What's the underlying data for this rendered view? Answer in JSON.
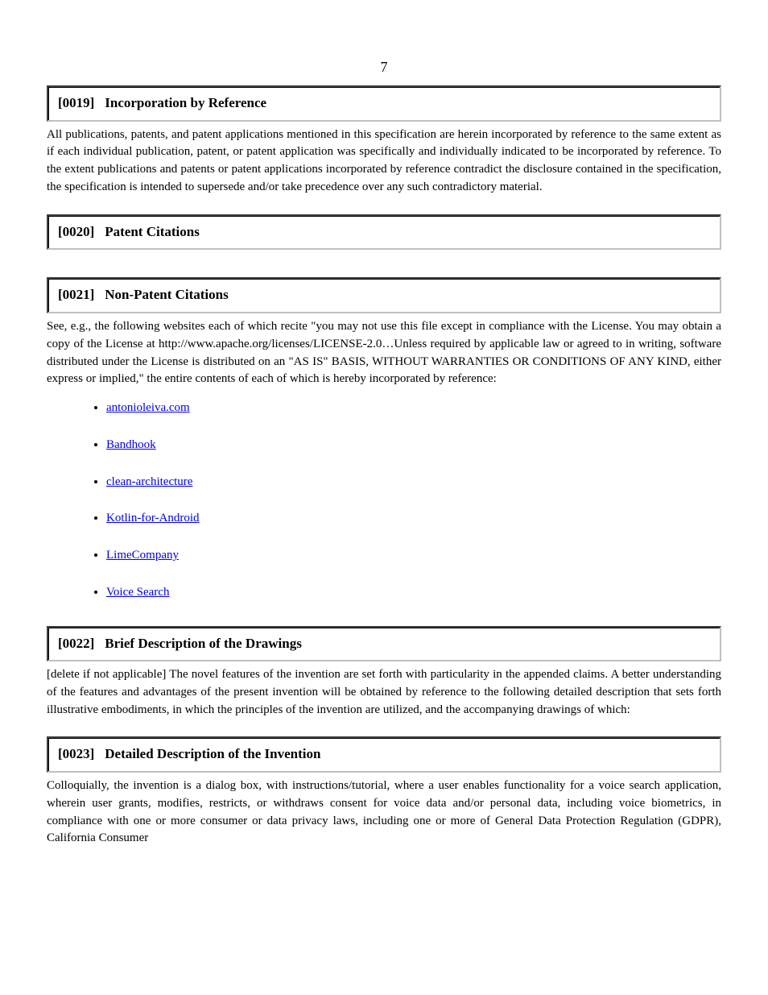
{
  "pageNumber": "7",
  "sections": [
    {
      "ref": "[0019]",
      "title": "Incorporation by Reference",
      "paras": [
        "All publications, patents, and patent applications mentioned in this specification are herein incorporated by reference to the same extent as if each individual publication, patent, or patent application was specifically and individually indicated to be incorporated by reference. To the extent publications and patents or patent applications incorporated by reference contradict the disclosure contained in the specification, the specification is intended to supersede and/or take precedence over any such contradictory material."
      ]
    },
    {
      "ref": "[0020]",
      "title": "Patent Citations"
    },
    {
      "ref": "[0021]",
      "title": "Non-Patent Citations",
      "paras": [
        "See, e.g., the following websites each of which recite \"you may not use this file except in compliance with the License. You may obtain a copy of the License at http://www.apache.org/licenses/LICENSE-2.0…Unless required by applicable law or agreed to in writing, software distributed under the License is distributed on an \"AS IS\" BASIS, WITHOUT WARRANTIES OR CONDITIONS OF ANY KIND, either express or implied,\" the entire contents of each of which is hereby incorporated by reference:"
      ],
      "links": [
        {
          "text": "antonioleiva.com",
          "href": "https://github.com/antoniolg/antonioleiva.com"
        },
        {
          "text": "Bandhook",
          "href": "https://github.com/antoniolg/Bandhook-Kotlin"
        },
        {
          "text": "clean-architecture",
          "href": "https://github.com/antoniolg/clean-architecture"
        },
        {
          "text": "Kotlin-for-Android",
          "href": "https://github.com/antoniolg/Kotlin-for-Android-Developers"
        },
        {
          "text": "LimeCompany",
          "href": "https://github.com/antoniolg/LimeApp"
        },
        {
          "text": "Voice Search",
          "href": "https://github.com/antoniolg/Voice-Search"
        }
      ]
    },
    {
      "ref": "[0022]",
      "title": "Brief Description of the Drawings",
      "paras": [
        "[delete if not applicable] The novel features of the invention are set forth with particularity in the appended claims. A better understanding of the features and advantages of the present invention will be obtained by reference to the following detailed description that sets forth illustrative embodiments, in which the principles of the invention are utilized, and the accompanying drawings of which:"
      ]
    },
    {
      "ref": "[0023]",
      "title": "Detailed Description of the Invention",
      "paras": [
        "Colloquially, the invention is a dialog box, with instructions/tutorial, where a user enables functionality for a voice search application, wherein user grants, modifies, restricts, or withdraws consent for voice data and/or personal data, including voice biometrics, in compliance with one or more consumer or data privacy laws, including one or more of General Data Protection Regulation (GDPR), California Consumer"
      ]
    }
  ]
}
